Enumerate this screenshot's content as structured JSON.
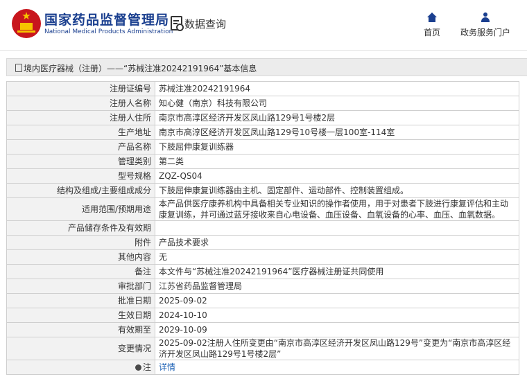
{
  "header": {
    "logo_name": "national-emblem-logo",
    "brand_cn": "国家药品监督管理局",
    "brand_en": "National Medical Products Administration",
    "query_title": "数据查询",
    "nav": [
      {
        "label": "首页",
        "icon": "home-icon"
      },
      {
        "label": "政务服务门户",
        "icon": "user-icon"
      }
    ]
  },
  "breadcrumb": {
    "text": "境内医疗器械（注册）——“苏械注准20242191964”基本信息"
  },
  "colors": {
    "brand_blue": "#1a3f8f",
    "emblem_red": "#c8161d",
    "label_bg": "#f2f2f2",
    "link_blue": "#1a5fb4"
  },
  "rows": [
    {
      "label": "注册证编号",
      "value": "苏械注准20242191964"
    },
    {
      "label": "注册人名称",
      "value": "知心健（南京）科技有限公司"
    },
    {
      "label": "注册人住所",
      "value": "南京市高淳区经济开发区凤山路129号1号楼2层"
    },
    {
      "label": "生产地址",
      "value": "南京市高淳区经济开发区凤山路129号10号楼一层100室-114室"
    },
    {
      "label": "产品名称",
      "value": "下肢屈伸康复训练器"
    },
    {
      "label": "管理类别",
      "value": "第二类"
    },
    {
      "label": "型号规格",
      "value": "ZQZ-QS04"
    },
    {
      "label": "结构及组成/主要组成成分",
      "value": "下肢屈伸康复训练器由主机、固定部件、运动部件、控制装置组成。"
    },
    {
      "label": "适用范围/预期用途",
      "value": "本产品供医疗康养机构中具备相关专业知识的操作者使用，用于对患者下肢进行康复评估和主动康复训练，并可通过蓝牙接收来自心电设备、血压设备、血氧设备的心率、血压、血氧数据。"
    },
    {
      "label": "产品储存条件及有效期",
      "value": ""
    },
    {
      "label": "附件",
      "value": "产品技术要求"
    },
    {
      "label": "其他内容",
      "value": "无"
    },
    {
      "label": "备注",
      "value": "本文件与“苏械注准20242191964”医疗器械注册证共同使用"
    },
    {
      "label": "审批部门",
      "value": "江苏省药品监督管理局"
    },
    {
      "label": "批准日期",
      "value": "2025-09-02"
    },
    {
      "label": "生效日期",
      "value": "2024-10-10"
    },
    {
      "label": "有效期至",
      "value": "2029-10-09"
    },
    {
      "label": "变更情况",
      "value": "2025-09-02注册人住所变更由“南京市高淳区经济开发区凤山路129号”变更为“南京市高淳区经济开发区凤山路129号1号楼2层”"
    }
  ],
  "note_row": {
    "label": "注",
    "icon": "note-icon",
    "link": "详情"
  }
}
